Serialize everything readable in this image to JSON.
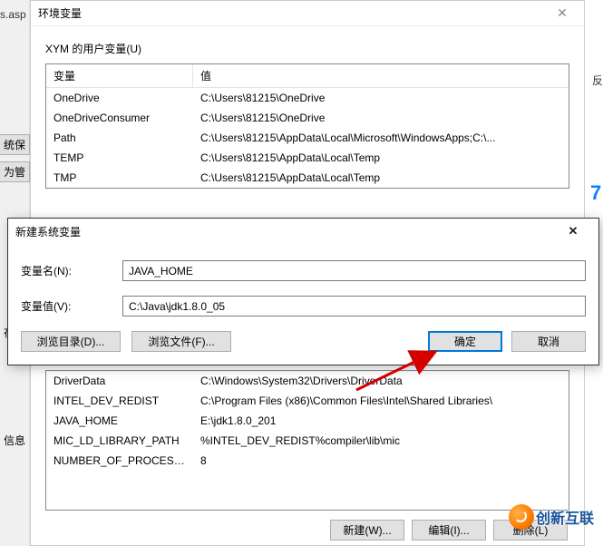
{
  "left_edge": {
    "asp_text": "s.asp",
    "btn1": "统保",
    "btn2": "为管",
    "txt3": "存储",
    "txt4": "信息"
  },
  "env": {
    "title": "环境变量",
    "user_section_label": "XYM 的用户变量(U)",
    "headers": {
      "name": "变量",
      "value": "值"
    },
    "user_rows": [
      {
        "name": "OneDrive",
        "value": "C:\\Users\\81215\\OneDrive"
      },
      {
        "name": "OneDriveConsumer",
        "value": "C:\\Users\\81215\\OneDrive"
      },
      {
        "name": "Path",
        "value": "C:\\Users\\81215\\AppData\\Local\\Microsoft\\WindowsApps;C:\\..."
      },
      {
        "name": "TEMP",
        "value": "C:\\Users\\81215\\AppData\\Local\\Temp"
      },
      {
        "name": "TMP",
        "value": "C:\\Users\\81215\\AppData\\Local\\Temp"
      }
    ],
    "sys_rows": [
      {
        "name": "DriverData",
        "value": "C:\\Windows\\System32\\Drivers\\DriverData"
      },
      {
        "name": "INTEL_DEV_REDIST",
        "value": "C:\\Program Files (x86)\\Common Files\\Intel\\Shared Libraries\\"
      },
      {
        "name": "JAVA_HOME",
        "value": "E:\\jdk1.8.0_201"
      },
      {
        "name": "MIC_LD_LIBRARY_PATH",
        "value": "%INTEL_DEV_REDIST%compiler\\lib\\mic"
      },
      {
        "name": "NUMBER_OF_PROCESSORS",
        "value": "8"
      }
    ],
    "buttons": {
      "new": "新建(W)...",
      "edit": "编辑(I)...",
      "delete": "删除(L)"
    }
  },
  "new_var": {
    "title": "新建系统变量",
    "name_label": "变量名(N):",
    "value_label": "变量值(V):",
    "name_value": "JAVA_HOME",
    "value_value": "C:\\Java\\jdk1.8.0_05",
    "browse_dir": "浏览目录(D)...",
    "browse_file": "浏览文件(F)...",
    "ok": "确定",
    "cancel": "取消"
  },
  "logo_text": "创新互联",
  "right_feedback": "反"
}
